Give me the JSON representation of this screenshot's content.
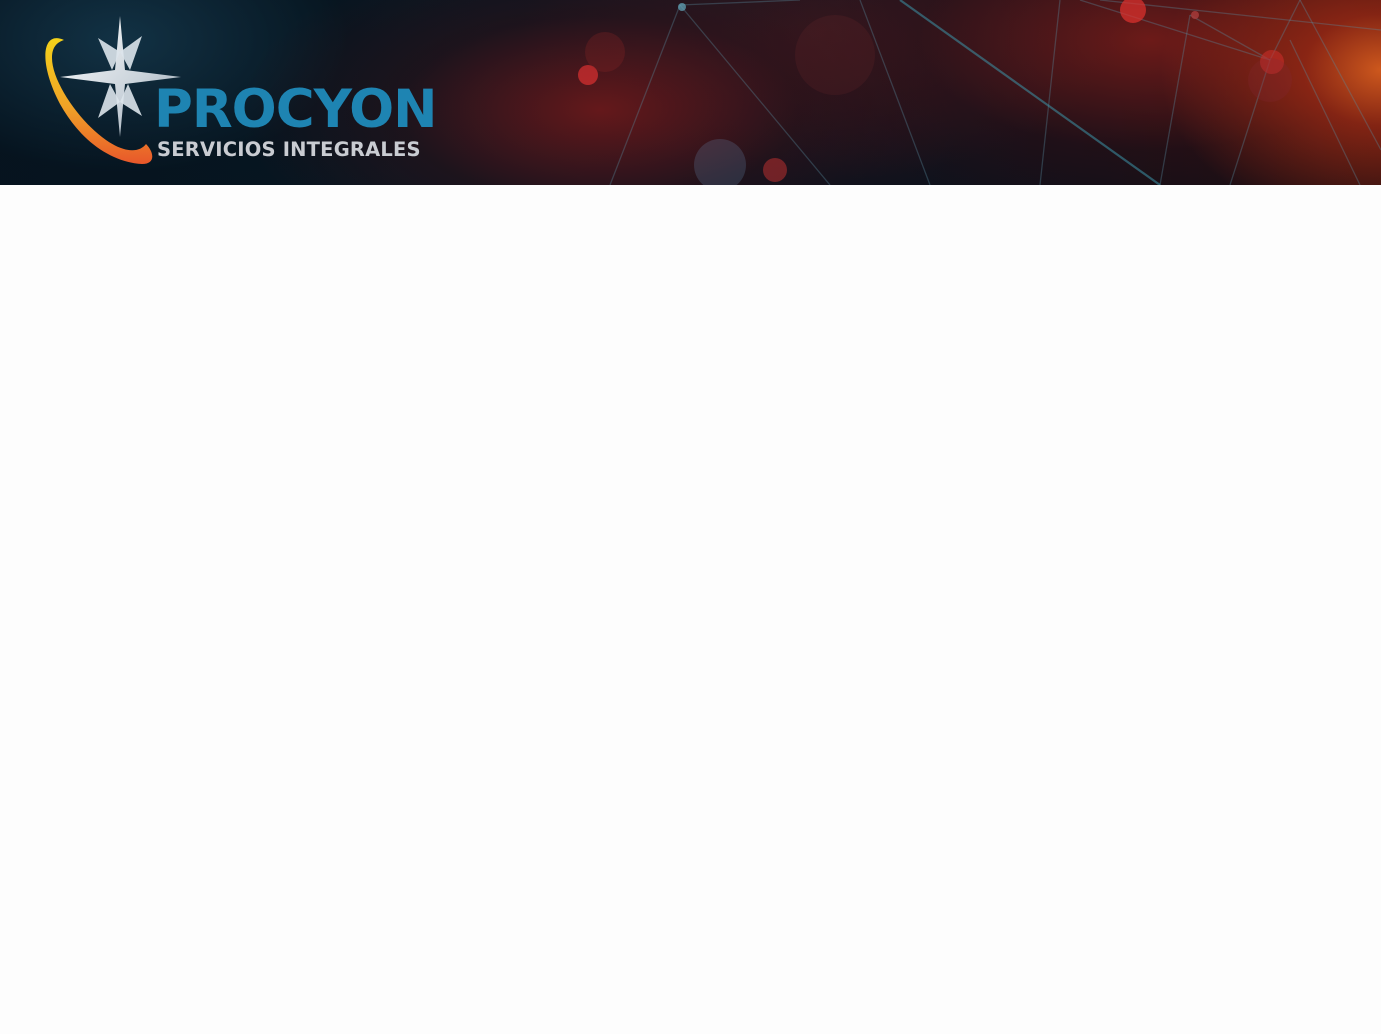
{
  "header": {
    "brand_name": "PROCYON",
    "tagline": "SERVICIOS INTEGRALES",
    "logo_icon": "star-orbit-logo-icon"
  },
  "colors": {
    "brand_blue": "#1e84b2",
    "tagline_gray": "#c9ccd2",
    "banner_dark": "#06131f",
    "banner_red": "#8c1e19",
    "banner_orange": "#d65c1e",
    "orbit_yellow": "#f3d21a",
    "orbit_orange": "#e8572a",
    "page_background": "#fdfdfd"
  }
}
